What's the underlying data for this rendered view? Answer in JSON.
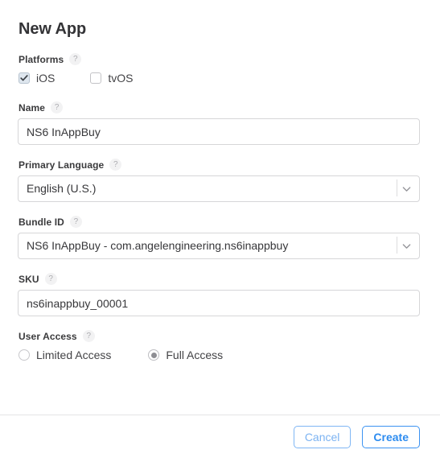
{
  "dialog": {
    "title": "New App"
  },
  "fields": {
    "platforms": {
      "label": "Platforms",
      "help": "?",
      "options": [
        {
          "label": "iOS",
          "checked": true
        },
        {
          "label": "tvOS",
          "checked": false
        }
      ]
    },
    "name": {
      "label": "Name",
      "help": "?",
      "value": "NS6 InAppBuy",
      "placeholder": ""
    },
    "primary_language": {
      "label": "Primary Language",
      "help": "?",
      "value": "English (U.S.)",
      "icon": "chevron-down-icon"
    },
    "bundle_id": {
      "label": "Bundle ID",
      "help": "?",
      "value": "NS6 InAppBuy - com.angelengineering.ns6inappbuy",
      "icon": "chevron-down-icon"
    },
    "sku": {
      "label": "SKU",
      "help": "?",
      "value": "ns6inappbuy_00001",
      "placeholder": ""
    },
    "user_access": {
      "label": "User Access",
      "help": "?",
      "options": [
        {
          "label": "Limited Access",
          "selected": false
        },
        {
          "label": "Full Access",
          "selected": true
        }
      ]
    }
  },
  "footer": {
    "cancel_label": "Cancel",
    "create_label": "Create"
  },
  "colors": {
    "accent_blue": "#2d8cf0",
    "cancel_blue": "#7cb3f2",
    "border_gray": "#d6d6d8",
    "label_gray": "#3a3a3c",
    "checkbox_checked_fill": "#dfe7ef",
    "radio_dot": "#8e8e93",
    "help_bg": "#f2f2f3"
  }
}
